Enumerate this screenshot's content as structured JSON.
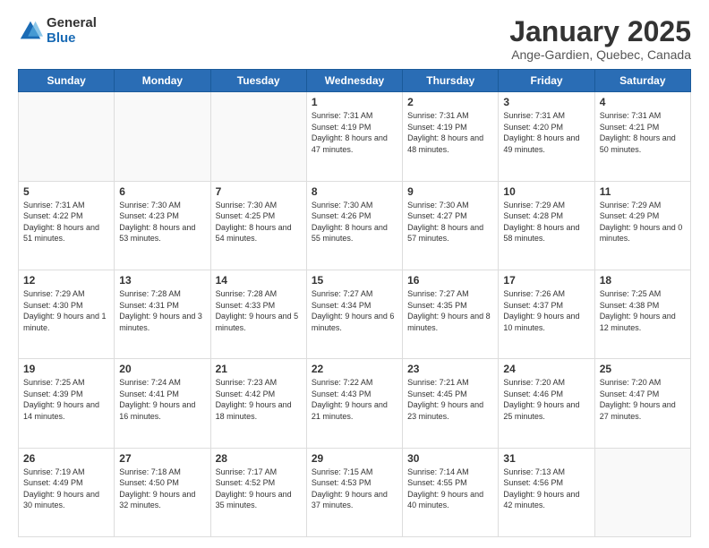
{
  "logo": {
    "general": "General",
    "blue": "Blue"
  },
  "title": "January 2025",
  "subtitle": "Ange-Gardien, Quebec, Canada",
  "days_header": [
    "Sunday",
    "Monday",
    "Tuesday",
    "Wednesday",
    "Thursday",
    "Friday",
    "Saturday"
  ],
  "weeks": [
    [
      {
        "day": "",
        "info": ""
      },
      {
        "day": "",
        "info": ""
      },
      {
        "day": "",
        "info": ""
      },
      {
        "day": "1",
        "info": "Sunrise: 7:31 AM\nSunset: 4:19 PM\nDaylight: 8 hours and 47 minutes."
      },
      {
        "day": "2",
        "info": "Sunrise: 7:31 AM\nSunset: 4:19 PM\nDaylight: 8 hours and 48 minutes."
      },
      {
        "day": "3",
        "info": "Sunrise: 7:31 AM\nSunset: 4:20 PM\nDaylight: 8 hours and 49 minutes."
      },
      {
        "day": "4",
        "info": "Sunrise: 7:31 AM\nSunset: 4:21 PM\nDaylight: 8 hours and 50 minutes."
      }
    ],
    [
      {
        "day": "5",
        "info": "Sunrise: 7:31 AM\nSunset: 4:22 PM\nDaylight: 8 hours and 51 minutes."
      },
      {
        "day": "6",
        "info": "Sunrise: 7:30 AM\nSunset: 4:23 PM\nDaylight: 8 hours and 53 minutes."
      },
      {
        "day": "7",
        "info": "Sunrise: 7:30 AM\nSunset: 4:25 PM\nDaylight: 8 hours and 54 minutes."
      },
      {
        "day": "8",
        "info": "Sunrise: 7:30 AM\nSunset: 4:26 PM\nDaylight: 8 hours and 55 minutes."
      },
      {
        "day": "9",
        "info": "Sunrise: 7:30 AM\nSunset: 4:27 PM\nDaylight: 8 hours and 57 minutes."
      },
      {
        "day": "10",
        "info": "Sunrise: 7:29 AM\nSunset: 4:28 PM\nDaylight: 8 hours and 58 minutes."
      },
      {
        "day": "11",
        "info": "Sunrise: 7:29 AM\nSunset: 4:29 PM\nDaylight: 9 hours and 0 minutes."
      }
    ],
    [
      {
        "day": "12",
        "info": "Sunrise: 7:29 AM\nSunset: 4:30 PM\nDaylight: 9 hours and 1 minute."
      },
      {
        "day": "13",
        "info": "Sunrise: 7:28 AM\nSunset: 4:31 PM\nDaylight: 9 hours and 3 minutes."
      },
      {
        "day": "14",
        "info": "Sunrise: 7:28 AM\nSunset: 4:33 PM\nDaylight: 9 hours and 5 minutes."
      },
      {
        "day": "15",
        "info": "Sunrise: 7:27 AM\nSunset: 4:34 PM\nDaylight: 9 hours and 6 minutes."
      },
      {
        "day": "16",
        "info": "Sunrise: 7:27 AM\nSunset: 4:35 PM\nDaylight: 9 hours and 8 minutes."
      },
      {
        "day": "17",
        "info": "Sunrise: 7:26 AM\nSunset: 4:37 PM\nDaylight: 9 hours and 10 minutes."
      },
      {
        "day": "18",
        "info": "Sunrise: 7:25 AM\nSunset: 4:38 PM\nDaylight: 9 hours and 12 minutes."
      }
    ],
    [
      {
        "day": "19",
        "info": "Sunrise: 7:25 AM\nSunset: 4:39 PM\nDaylight: 9 hours and 14 minutes."
      },
      {
        "day": "20",
        "info": "Sunrise: 7:24 AM\nSunset: 4:41 PM\nDaylight: 9 hours and 16 minutes."
      },
      {
        "day": "21",
        "info": "Sunrise: 7:23 AM\nSunset: 4:42 PM\nDaylight: 9 hours and 18 minutes."
      },
      {
        "day": "22",
        "info": "Sunrise: 7:22 AM\nSunset: 4:43 PM\nDaylight: 9 hours and 21 minutes."
      },
      {
        "day": "23",
        "info": "Sunrise: 7:21 AM\nSunset: 4:45 PM\nDaylight: 9 hours and 23 minutes."
      },
      {
        "day": "24",
        "info": "Sunrise: 7:20 AM\nSunset: 4:46 PM\nDaylight: 9 hours and 25 minutes."
      },
      {
        "day": "25",
        "info": "Sunrise: 7:20 AM\nSunset: 4:47 PM\nDaylight: 9 hours and 27 minutes."
      }
    ],
    [
      {
        "day": "26",
        "info": "Sunrise: 7:19 AM\nSunset: 4:49 PM\nDaylight: 9 hours and 30 minutes."
      },
      {
        "day": "27",
        "info": "Sunrise: 7:18 AM\nSunset: 4:50 PM\nDaylight: 9 hours and 32 minutes."
      },
      {
        "day": "28",
        "info": "Sunrise: 7:17 AM\nSunset: 4:52 PM\nDaylight: 9 hours and 35 minutes."
      },
      {
        "day": "29",
        "info": "Sunrise: 7:15 AM\nSunset: 4:53 PM\nDaylight: 9 hours and 37 minutes."
      },
      {
        "day": "30",
        "info": "Sunrise: 7:14 AM\nSunset: 4:55 PM\nDaylight: 9 hours and 40 minutes."
      },
      {
        "day": "31",
        "info": "Sunrise: 7:13 AM\nSunset: 4:56 PM\nDaylight: 9 hours and 42 minutes."
      },
      {
        "day": "",
        "info": ""
      }
    ]
  ]
}
